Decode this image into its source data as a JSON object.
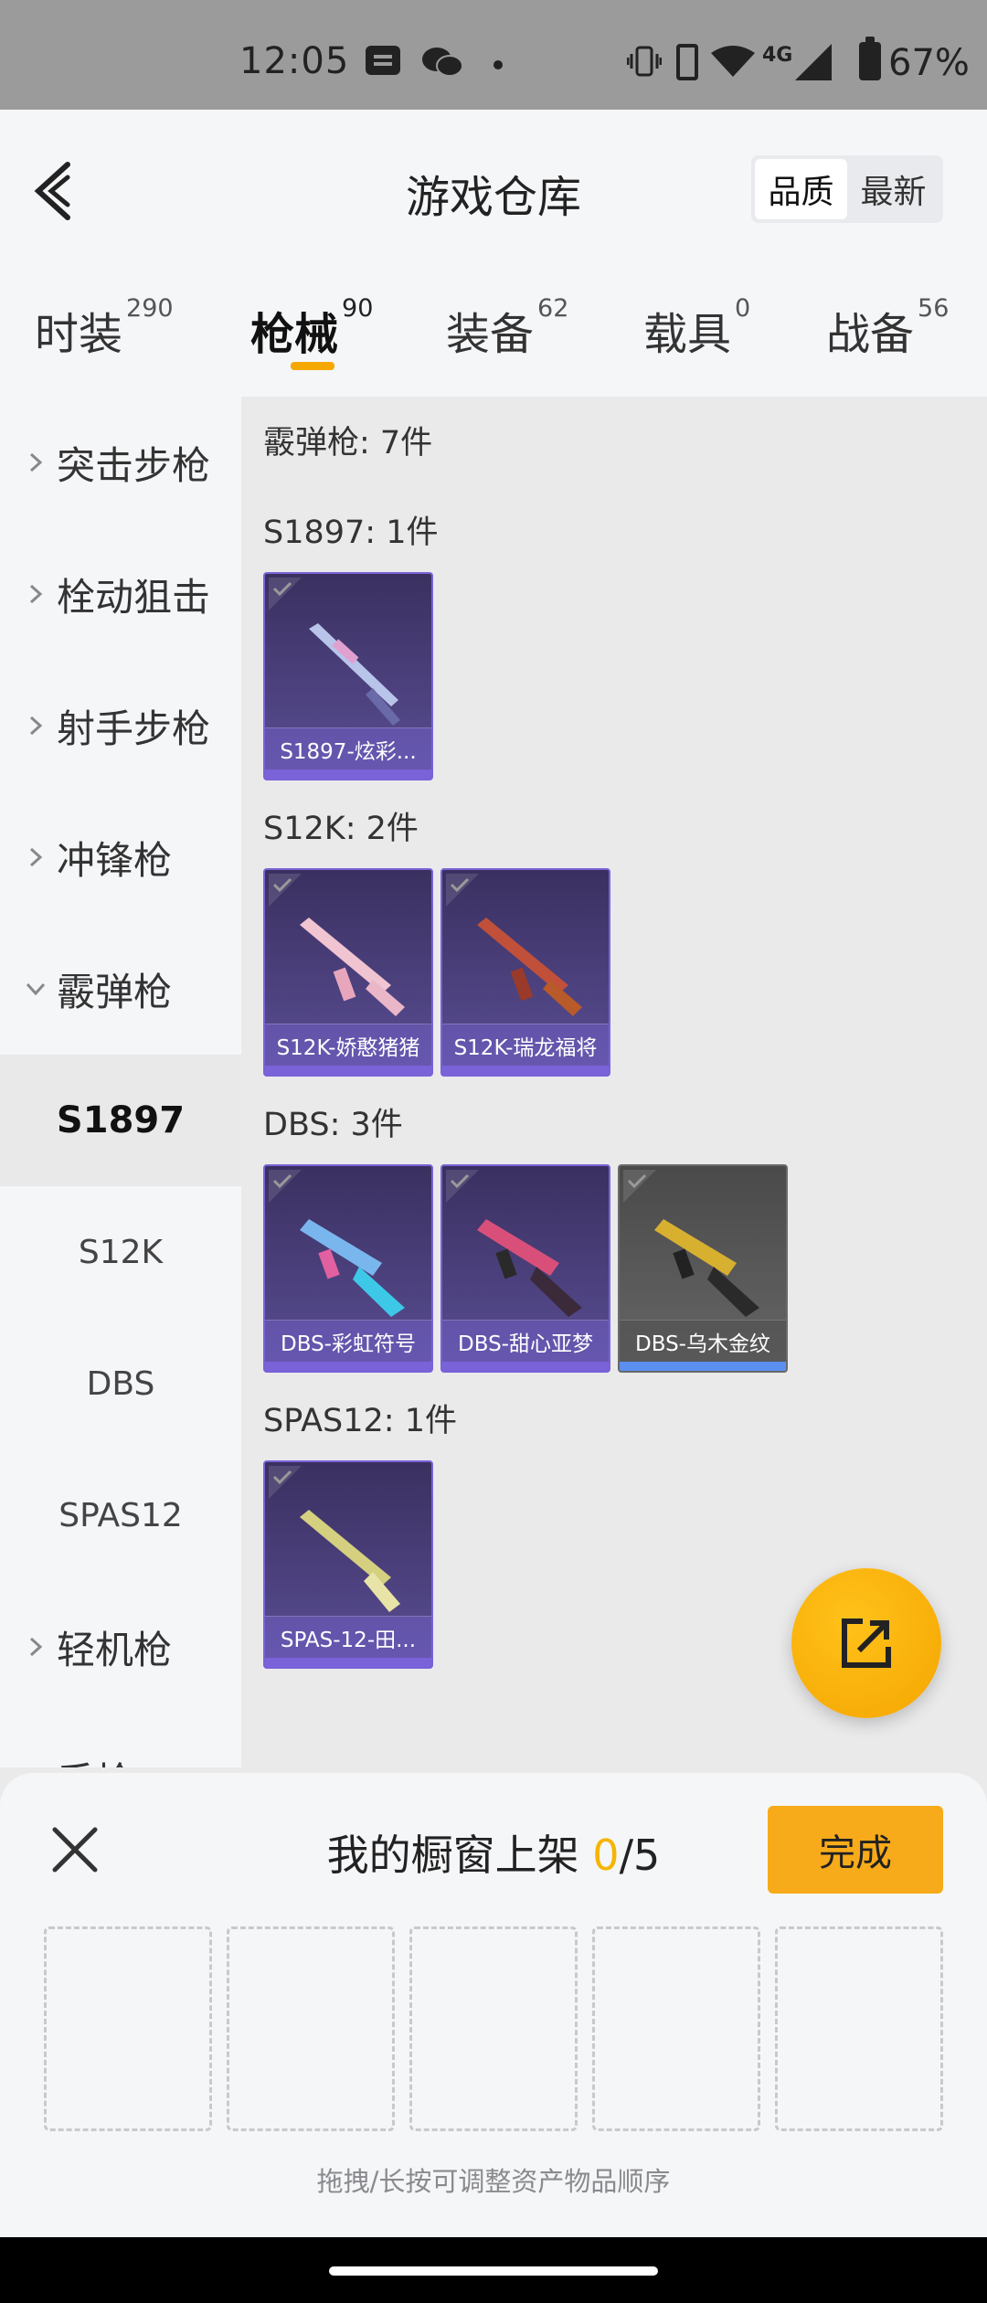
{
  "status_bar": {
    "time": "12:05",
    "network": "4G",
    "battery": "67%"
  },
  "header": {
    "title": "游戏仓库",
    "sort_options": [
      "品质",
      "最新"
    ],
    "active_sort": "品质"
  },
  "categories": [
    {
      "label": "时装",
      "count": "290"
    },
    {
      "label": "枪械",
      "count": "90"
    },
    {
      "label": "装备",
      "count": "62"
    },
    {
      "label": "载具",
      "count": "0"
    },
    {
      "label": "战备",
      "count": "56"
    }
  ],
  "sidebar": {
    "items": [
      {
        "label": "突击步枪"
      },
      {
        "label": "栓动狙击"
      },
      {
        "label": "射手步枪"
      },
      {
        "label": "冲锋枪"
      },
      {
        "label": "霰弹枪"
      },
      {
        "label": "S1897"
      },
      {
        "label": "S12K"
      },
      {
        "label": "DBS"
      },
      {
        "label": "SPAS12"
      },
      {
        "label": "轻机枪"
      },
      {
        "label": "手枪"
      }
    ]
  },
  "content": {
    "header": "霰弹枪: 7件",
    "sections": [
      {
        "title": "S1897: 1件",
        "items": [
          {
            "name": "S1897-炫彩..."
          }
        ]
      },
      {
        "title": "S12K: 2件",
        "items": [
          {
            "name": "S12K-娇憨猪猪"
          },
          {
            "name": "S12K-瑞龙福将"
          }
        ]
      },
      {
        "title": "DBS: 3件",
        "items": [
          {
            "name": "DBS-彩虹符号"
          },
          {
            "name": "DBS-甜心亚梦"
          },
          {
            "name": "DBS-乌木金纹"
          }
        ]
      },
      {
        "title": "SPAS12: 1件",
        "items": [
          {
            "name": "SPAS-12-田..."
          }
        ]
      }
    ]
  },
  "panel": {
    "title_prefix": "我的橱窗上架 ",
    "count": "0",
    "total": "/5",
    "done_label": "完成",
    "hint": "拖拽/长按可调整资产物品顺序"
  },
  "colors": {
    "accent": "#f5a800",
    "card_border": "#7a62d8"
  }
}
